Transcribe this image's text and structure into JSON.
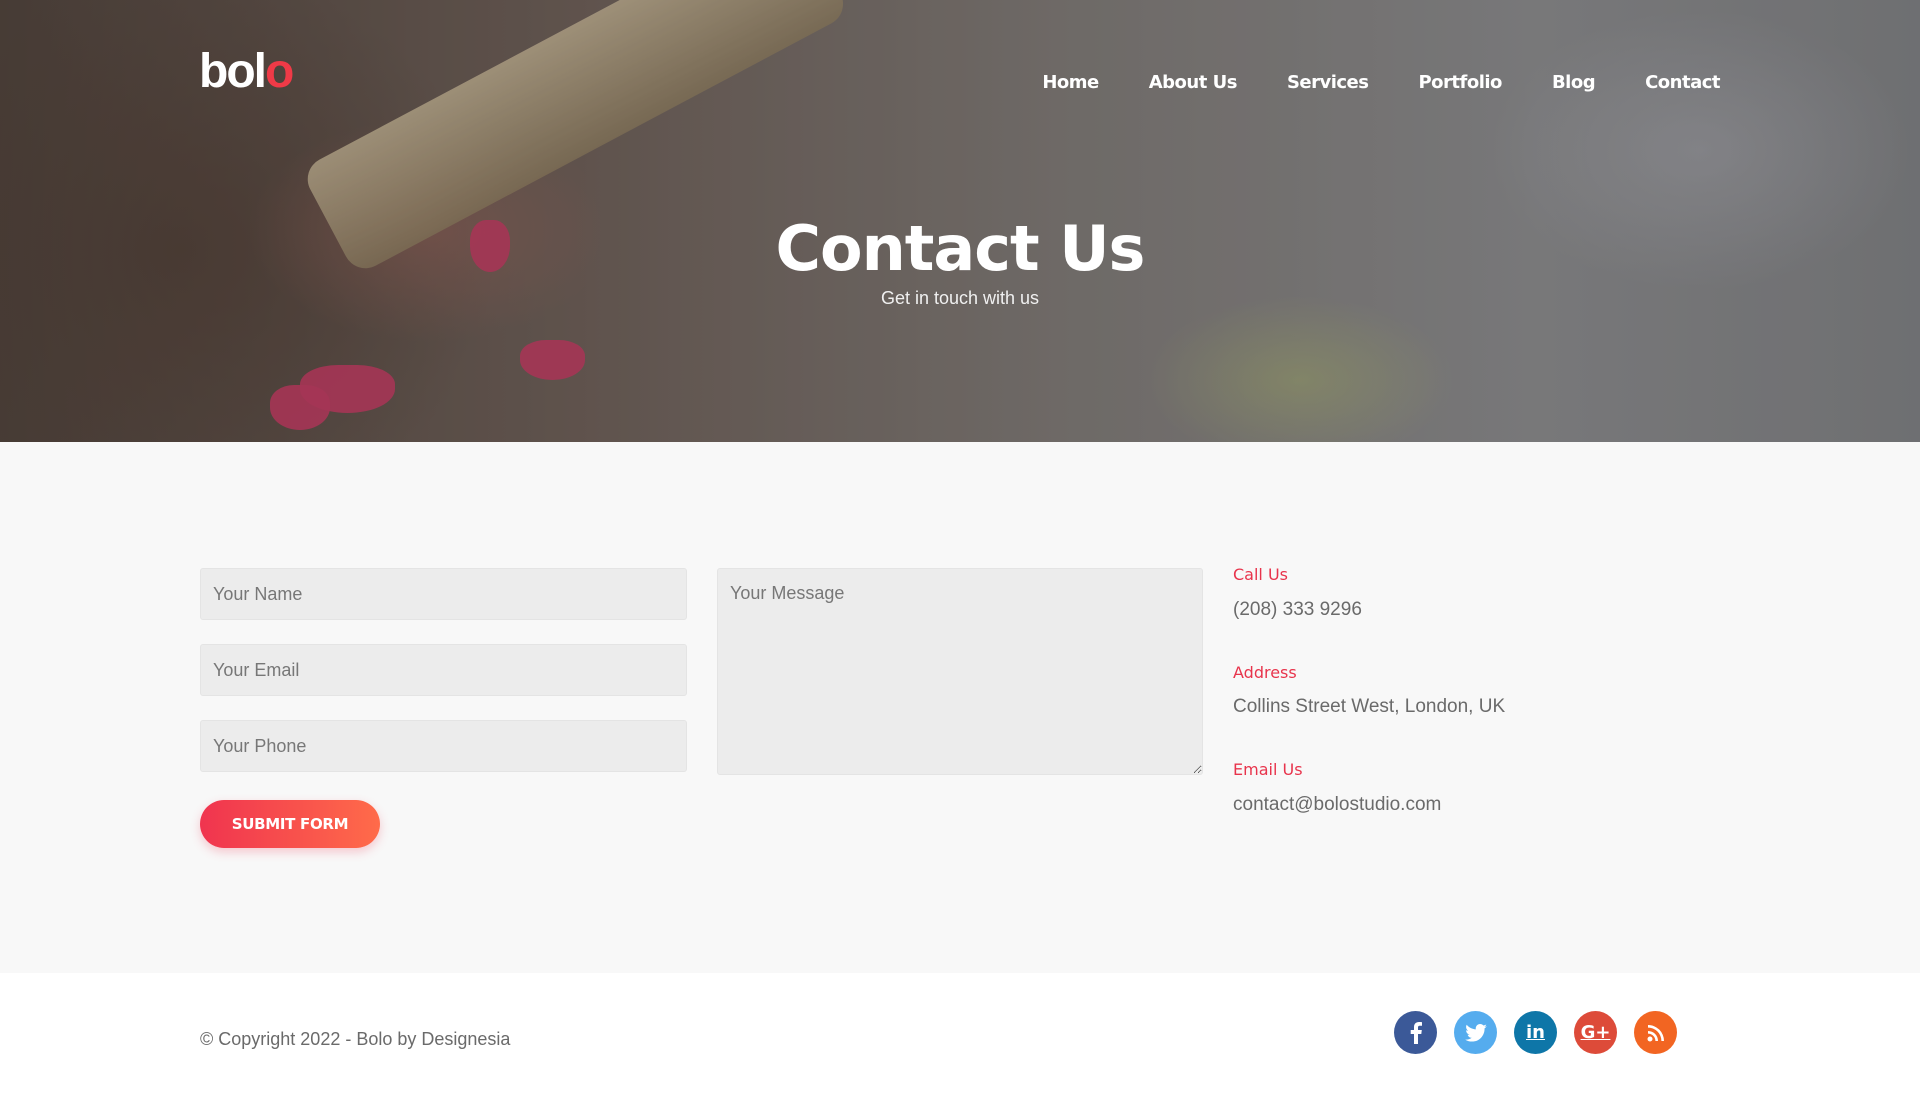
{
  "brand": {
    "logo_main": "bol",
    "logo_accent": "o"
  },
  "nav": {
    "items": [
      "Home",
      "About Us",
      "Services",
      "Portfolio",
      "Blog",
      "Contact"
    ]
  },
  "hero": {
    "title": "Contact Us",
    "subtitle": "Get in touch with us"
  },
  "form": {
    "name_placeholder": "Your Name",
    "email_placeholder": "Your Email",
    "phone_placeholder": "Your Phone",
    "message_placeholder": "Your Message",
    "submit_label": "SUBMIT FORM"
  },
  "contact_info": {
    "call_label": "Call Us",
    "call_value": "(208) 333 9296",
    "address_label": "Address",
    "address_value": "Collins Street West, London, UK",
    "email_label": "Email Us",
    "email_value": "contact@bolostudio.com"
  },
  "footer": {
    "copyright": "© Copyright 2022 - Bolo by Designesia",
    "social": [
      {
        "name": "facebook-icon",
        "glyph": "f",
        "color": "#3b5998"
      },
      {
        "name": "twitter-icon",
        "glyph": "t",
        "color": "#55acee"
      },
      {
        "name": "linkedin-icon",
        "glyph": "in",
        "color": "#0e76a8"
      },
      {
        "name": "google-plus-icon",
        "glyph": "G+",
        "color": "#dd4b39"
      },
      {
        "name": "rss-icon",
        "glyph": "rss",
        "color": "#f26522"
      }
    ]
  },
  "colors": {
    "accent": "#e8344c",
    "button_start": "#f0344f",
    "button_end": "#ff6b4a"
  }
}
